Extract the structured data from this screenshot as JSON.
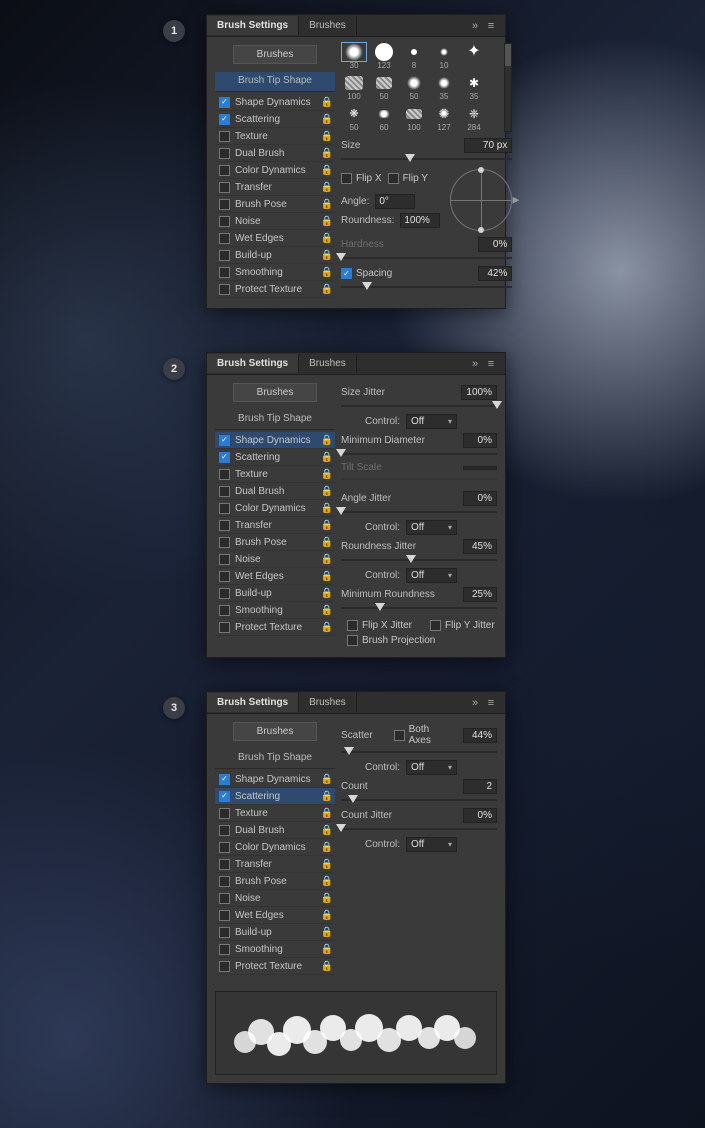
{
  "steps": [
    "1",
    "2",
    "3"
  ],
  "header": {
    "tab_settings": "Brush Settings",
    "tab_brushes": "Brushes",
    "menu_icon": "≡",
    "collapse_icon": "»"
  },
  "sidebar": {
    "brushes_btn": "Brushes",
    "tip_shape": "Brush Tip Shape",
    "items": [
      {
        "label": "Shape Dynamics",
        "checked": true
      },
      {
        "label": "Scattering",
        "checked": true
      },
      {
        "label": "Texture",
        "checked": false
      },
      {
        "label": "Dual Brush",
        "checked": false
      },
      {
        "label": "Color Dynamics",
        "checked": false
      },
      {
        "label": "Transfer",
        "checked": false
      },
      {
        "label": "Brush Pose",
        "checked": false
      },
      {
        "label": "Noise",
        "checked": false
      },
      {
        "label": "Wet Edges",
        "checked": false
      },
      {
        "label": "Build-up",
        "checked": false
      },
      {
        "label": "Smoothing",
        "checked": false
      },
      {
        "label": "Protect Texture",
        "checked": false
      }
    ]
  },
  "panel1": {
    "brush_sizes": [
      "30",
      "123",
      "8",
      "10",
      "",
      " ",
      "100",
      "50",
      "50",
      "35",
      "35",
      "50",
      "60",
      "100",
      "127",
      "284"
    ],
    "size_label": "Size",
    "size_value": "70 px",
    "flipx": "Flip X",
    "flipy": "Flip Y",
    "angle_label": "Angle:",
    "angle_value": "0°",
    "round_label": "Roundness:",
    "round_value": "100%",
    "hard_label": "Hardness",
    "hard_value": "0%",
    "spacing_label": "Spacing",
    "spacing_value": "42%"
  },
  "panel2": {
    "size_jitter": "Size Jitter",
    "size_jitter_val": "100%",
    "control": "Control:",
    "off": "Off",
    "min_diam": "Minimum Diameter",
    "min_diam_val": "0%",
    "tilt": "Tilt Scale",
    "angle_jitter": "Angle Jitter",
    "angle_jitter_val": "0%",
    "round_jitter": "Roundness Jitter",
    "round_jitter_val": "45%",
    "min_round": "Minimum Roundness",
    "min_round_val": "25%",
    "flipx": "Flip X Jitter",
    "flipy": "Flip Y Jitter",
    "proj": "Brush Projection"
  },
  "panel3": {
    "scatter": "Scatter",
    "both": "Both Axes",
    "scatter_val": "44%",
    "control": "Control:",
    "off": "Off",
    "count": "Count",
    "count_val": "2",
    "count_jitter": "Count Jitter",
    "count_jitter_val": "0%"
  }
}
